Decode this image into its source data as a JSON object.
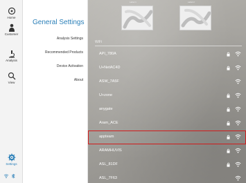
{
  "rail": {
    "items": [
      {
        "label": "Home"
      },
      {
        "label": "Customer"
      },
      {
        "label": "Analysis"
      },
      {
        "label": "View"
      }
    ],
    "settings_label": "Settings",
    "active_color": "#2a7fb8"
  },
  "menu": {
    "title": "General Settings",
    "items": [
      {
        "label": "Analysis Settings"
      },
      {
        "label": "Recommended Products"
      },
      {
        "label": "Device Activation"
      },
      {
        "label": "About"
      }
    ]
  },
  "content": {
    "thumbnails": [
      {
        "caption": "Label 1"
      },
      {
        "caption": "Label 2"
      }
    ],
    "wifi_section_label": "WiFi",
    "networks": [
      {
        "ssid": "API_780A",
        "locked": true,
        "selected": false
      },
      {
        "ssid": "U+NetAC4D",
        "locked": true,
        "selected": false
      },
      {
        "ssid": "ASW_7A5F",
        "locked": false,
        "selected": false
      },
      {
        "ssid": "U+zone",
        "locked": true,
        "selected": false
      },
      {
        "ssid": "anygate",
        "locked": true,
        "selected": false
      },
      {
        "ssid": "Aram_ACE",
        "locked": true,
        "selected": false
      },
      {
        "ssid": "appteam",
        "locked": true,
        "selected": true
      },
      {
        "ssid": "ARAMHUVIS",
        "locked": true,
        "selected": false
      },
      {
        "ssid": "ASL_81DF",
        "locked": true,
        "selected": false
      },
      {
        "ssid": "ASL_7F63",
        "locked": false,
        "selected": false
      }
    ],
    "selected_outline_color": "#d11a1a"
  }
}
